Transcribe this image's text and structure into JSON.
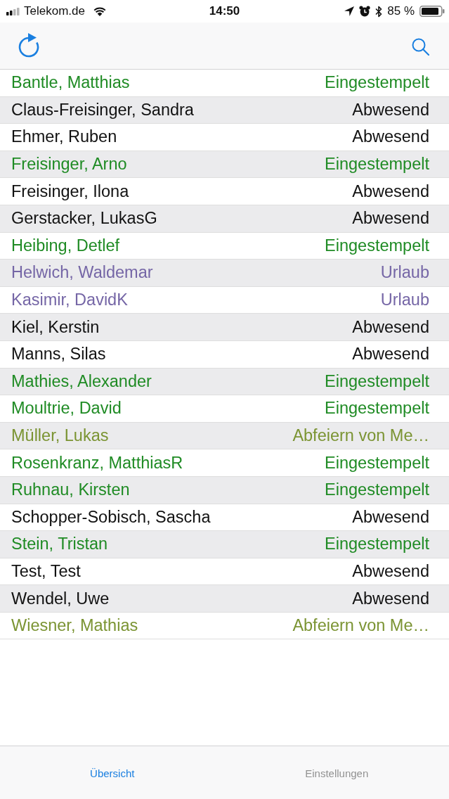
{
  "status_bar": {
    "carrier": "Telekom.de",
    "time": "14:50",
    "battery": "85 %"
  },
  "rows": [
    {
      "name": "Bantle, Matthias",
      "status": "Eingestempelt",
      "color": "#1f8b24"
    },
    {
      "name": "Claus-Freisinger, Sandra",
      "status": "Abwesend",
      "color": "#111111"
    },
    {
      "name": "Ehmer, Ruben",
      "status": "Abwesend",
      "color": "#111111"
    },
    {
      "name": "Freisinger, Arno",
      "status": "Eingestempelt",
      "color": "#1f8b24"
    },
    {
      "name": "Freisinger, Ilona",
      "status": "Abwesend",
      "color": "#111111"
    },
    {
      "name": "Gerstacker, LukasG",
      "status": "Abwesend",
      "color": "#111111"
    },
    {
      "name": "Heibing, Detlef",
      "status": "Eingestempelt",
      "color": "#1f8b24"
    },
    {
      "name": "Helwich, Waldemar",
      "status": "Urlaub",
      "color": "#7566a6"
    },
    {
      "name": "Kasimir, DavidK",
      "status": "Urlaub",
      "color": "#7566a6"
    },
    {
      "name": "Kiel, Kerstin",
      "status": "Abwesend",
      "color": "#111111"
    },
    {
      "name": "Manns, Silas",
      "status": "Abwesend",
      "color": "#111111"
    },
    {
      "name": "Mathies, Alexander",
      "status": "Eingestempelt",
      "color": "#1f8b24"
    },
    {
      "name": "Moultrie, David",
      "status": "Eingestempelt",
      "color": "#1f8b24"
    },
    {
      "name": "Müller, Lukas",
      "status": "Abfeiern von Me…",
      "color": "#7b9433"
    },
    {
      "name": "Rosenkranz, MatthiasR",
      "status": "Eingestempelt",
      "color": "#1f8b24"
    },
    {
      "name": "Ruhnau, Kirsten",
      "status": "Eingestempelt",
      "color": "#1f8b24"
    },
    {
      "name": "Schopper-Sobisch, Sascha",
      "status": "Abwesend",
      "color": "#111111"
    },
    {
      "name": "Stein, Tristan",
      "status": "Eingestempelt",
      "color": "#1f8b24"
    },
    {
      "name": "Test, Test",
      "status": "Abwesend",
      "color": "#111111"
    },
    {
      "name": "Wendel, Uwe",
      "status": "Abwesend",
      "color": "#111111"
    },
    {
      "name": "Wiesner, Mathias",
      "status": "Abfeiern von Me…",
      "color": "#7b9433"
    }
  ],
  "tabs": [
    {
      "label": "Übersicht",
      "selected": true
    },
    {
      "label": "Einstellungen",
      "selected": false
    }
  ]
}
